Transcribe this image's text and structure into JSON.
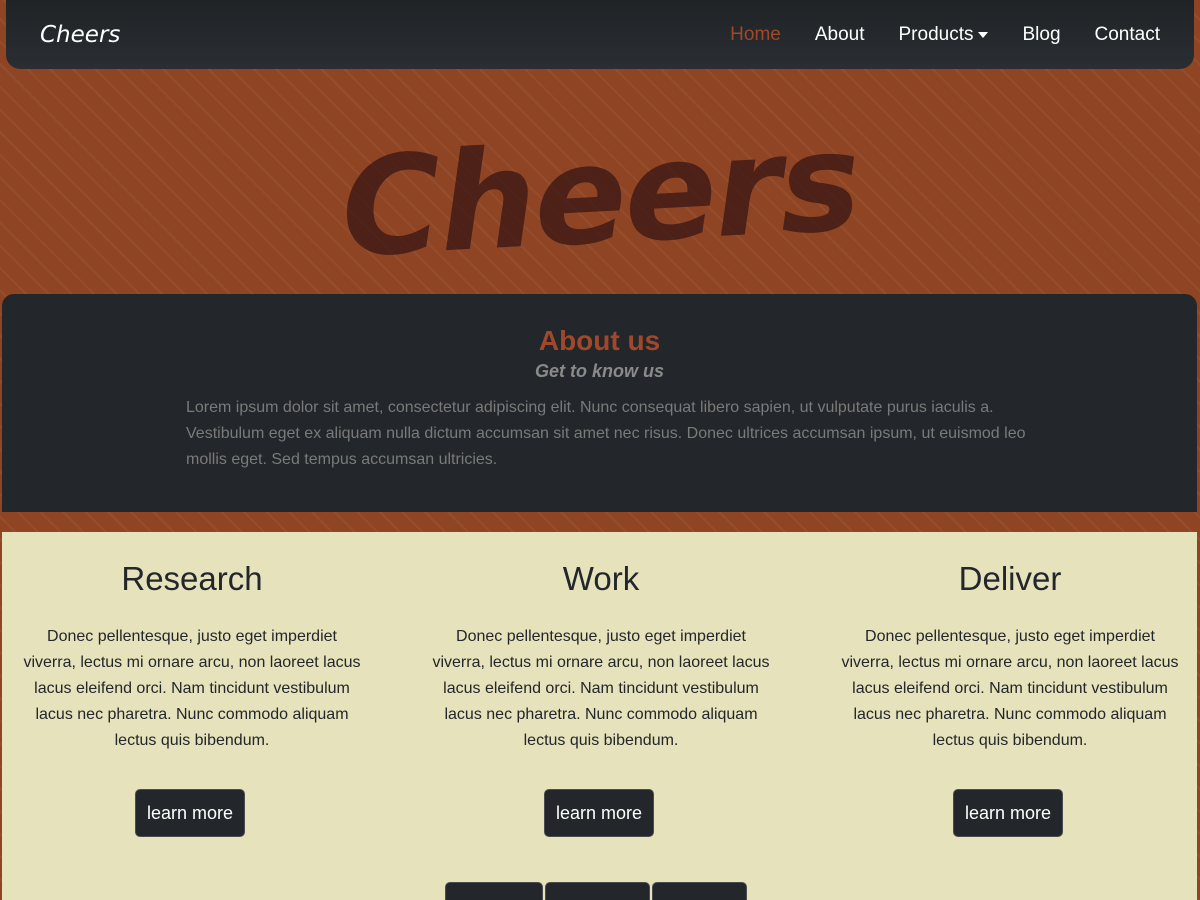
{
  "navbar": {
    "brand": "Cheers",
    "links": [
      {
        "label": "Home",
        "active": true
      },
      {
        "label": "About"
      },
      {
        "label": "Products",
        "dropdown": true
      },
      {
        "label": "Blog"
      },
      {
        "label": "Contact"
      }
    ]
  },
  "hero": {
    "title": "Cheers"
  },
  "about": {
    "title": "About us",
    "subtitle": "Get to know us",
    "text": "Lorem ipsum dolor sit amet, consectetur adipiscing elit. Nunc consequat libero sapien, ut vulputate purus iaculis a. Vestibulum eget ex aliquam nulla dictum accumsan sit amet nec risus. Donec ultrices accumsan ipsum, ut euismod leo mollis eget. Sed tempus accumsan ultricies."
  },
  "features": [
    {
      "title": "Research",
      "text": "Donec pellentesque, justo eget imperdiet viverra, lectus mi ornare arcu, non laoreet lacus lacus eleifend orci. Nam tincidunt vestibulum lacus nec pharetra. Nunc commodo aliquam lectus quis bibendum.",
      "button": "learn more"
    },
    {
      "title": "Work",
      "text": "Donec pellentesque, justo eget imperdiet viverra, lectus mi ornare arcu, non laoreet lacus lacus eleifend orci. Nam tincidunt vestibulum lacus nec pharetra. Nunc commodo aliquam lectus quis bibendum.",
      "button": "learn more"
    },
    {
      "title": "Deliver",
      "text": "Donec pellentesque, justo eget imperdiet viverra, lectus mi ornare arcu, non laoreet lacus lacus eleifend orci. Nam tincidunt vestibulum lacus nec pharetra. Nunc commodo aliquam lectus quis bibendum.",
      "button": "learn more"
    }
  ],
  "colors": {
    "background": "#8f4524",
    "dark": "#23262a",
    "accent": "#a0482a",
    "light_panel": "#e6e2bb"
  }
}
